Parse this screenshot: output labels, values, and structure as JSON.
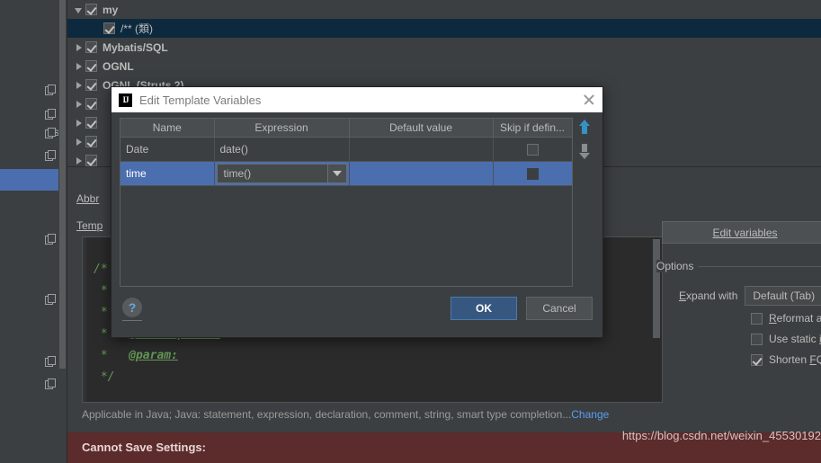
{
  "sidebar": {
    "partial_label": "es",
    "icon_name": "copy-icon",
    "icons_count": 8
  },
  "tree": {
    "rows": [
      {
        "arrow": "down",
        "checked": true,
        "label": "my",
        "bold": true,
        "selected": false,
        "indent": 0
      },
      {
        "arrow": "none",
        "checked": true,
        "label": "/** (類)",
        "bold": false,
        "selected": true,
        "indent": 1
      },
      {
        "arrow": "right",
        "checked": true,
        "label": "Mybatis/SQL",
        "bold": true,
        "selected": false,
        "indent": 0
      },
      {
        "arrow": "right",
        "checked": true,
        "label": "OGNL",
        "bold": true,
        "selected": false,
        "indent": 0
      },
      {
        "arrow": "right",
        "checked": true,
        "label": "OGNL (Struts 2)",
        "bold": true,
        "selected": false,
        "indent": 0
      },
      {
        "arrow": "right",
        "checked": true,
        "label": "",
        "bold": true,
        "selected": false,
        "indent": 0
      },
      {
        "arrow": "right",
        "checked": true,
        "label": "",
        "bold": true,
        "selected": false,
        "indent": 0
      },
      {
        "arrow": "right",
        "checked": true,
        "label": "",
        "bold": true,
        "selected": false,
        "indent": 0
      },
      {
        "arrow": "right",
        "checked": true,
        "label": "",
        "bold": true,
        "selected": false,
        "indent": 0
      }
    ]
  },
  "form": {
    "abbreviation_label": "Abbr",
    "template_label": "Temp",
    "edit_variables_button": "Edit variables",
    "applicable_text": "Applicable in Java; Java: statement, expression, declaration, comment, string, smart type completion...",
    "applicable_change_link": "Change"
  },
  "editor": {
    "lines": [
      {
        "text": "/*",
        "tag": ""
      },
      {
        "text": " *",
        "tag": ""
      },
      {
        "text": " *",
        "tag": ""
      },
      {
        "text": " *",
        "tag": "@Description:"
      },
      {
        "text": " *",
        "tag": "@param:"
      },
      {
        "text": " */",
        "tag": ""
      }
    ]
  },
  "options": {
    "title": "Options",
    "expand_with_label": "Expand with",
    "expand_with_value": "Default (Tab)",
    "checkboxes": [
      {
        "label": "Reformat according to",
        "checked": false
      },
      {
        "label": "Use static import if pos",
        "checked": false
      },
      {
        "label": "Shorten FQ names",
        "checked": true
      }
    ]
  },
  "error_bar": {
    "message": "Cannot Save Settings:",
    "watermark": "https://blog.csdn.net/weixin_45530192"
  },
  "dialog": {
    "title": "Edit Template Variables",
    "icon_name": "intellij-idea-icon",
    "close_icon": "close-icon",
    "columns": [
      "Name",
      "Expression",
      "Default value",
      "Skip if defin..."
    ],
    "rows": [
      {
        "name": "Date",
        "expression": "date()",
        "default_value": "",
        "skip": false,
        "selected": false,
        "editing": false
      },
      {
        "name": "time",
        "expression": "time()",
        "default_value": "",
        "skip": true,
        "selected": true,
        "editing": true
      }
    ],
    "help_label": "?",
    "ok_label": "OK",
    "cancel_label": "Cancel",
    "move_up_icon": "arrow-up-icon",
    "move_down_icon": "arrow-down-icon"
  },
  "colors": {
    "accent_blue": "#4b6eaf",
    "ok_button": "#365880",
    "error_bar": "#5c2b2b",
    "link": "#589df6",
    "code_green": "#629755",
    "arrow_active": "#3592c4"
  }
}
